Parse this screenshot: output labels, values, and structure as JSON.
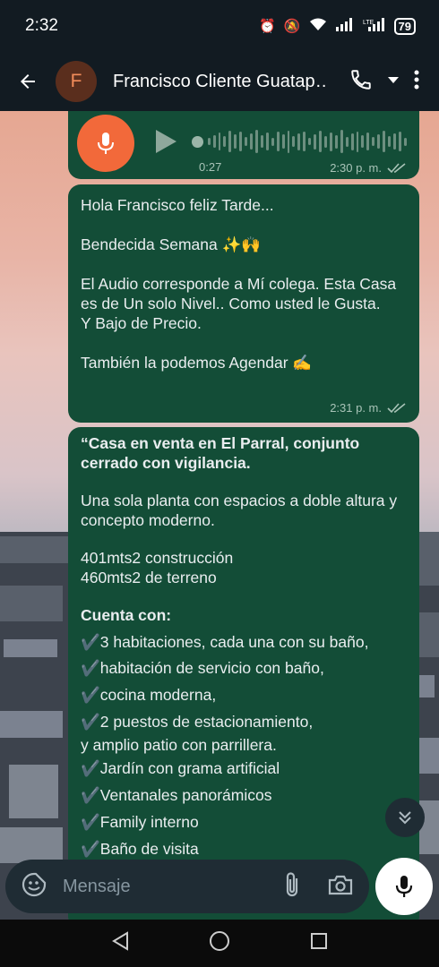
{
  "status_bar": {
    "time": "2:32",
    "battery": "79"
  },
  "header": {
    "avatar_letter": "F",
    "contact_name": "Francisco Cliente Guatap…"
  },
  "audio_message": {
    "duration": "0:27",
    "time": "2:30 p. m."
  },
  "message_1": {
    "lines": [
      "Hola Francisco feliz Tarde...",
      "Bendecida Semana ✨🙌",
      "El Audio corresponde a Mí colega. Esta Casa es de Un solo Nivel.. Como usted le Gusta.",
      "Y Bajo de Precio.",
      "También la podemos Agendar ✍️"
    ],
    "time": "2:31 p. m."
  },
  "message_2": {
    "heading": "“Casa en venta en El Parral, conjunto cerrado con vigilancia.",
    "intro": "Una sola planta con espacios a doble altura y concepto moderno.",
    "area_1": "401mts2 construcción",
    "area_2": "460mts2 de terreno",
    "features_title": "Cuenta con:",
    "features": [
      "3 habitaciones, cada una con su baño,",
      "habitación de servicio con baño,",
      "cocina moderna,",
      "2 puestos de estacionamiento,",
      "y amplio patio con parrillera.",
      "Jardín con grama artificial",
      "Ventanales panorámicos",
      "Family interno",
      "Baño de visita"
    ]
  },
  "composer": {
    "placeholder": "Mensaje"
  },
  "colors": {
    "bubble": "#134d37",
    "mic": "#f2693a",
    "bar": "#121b22"
  }
}
